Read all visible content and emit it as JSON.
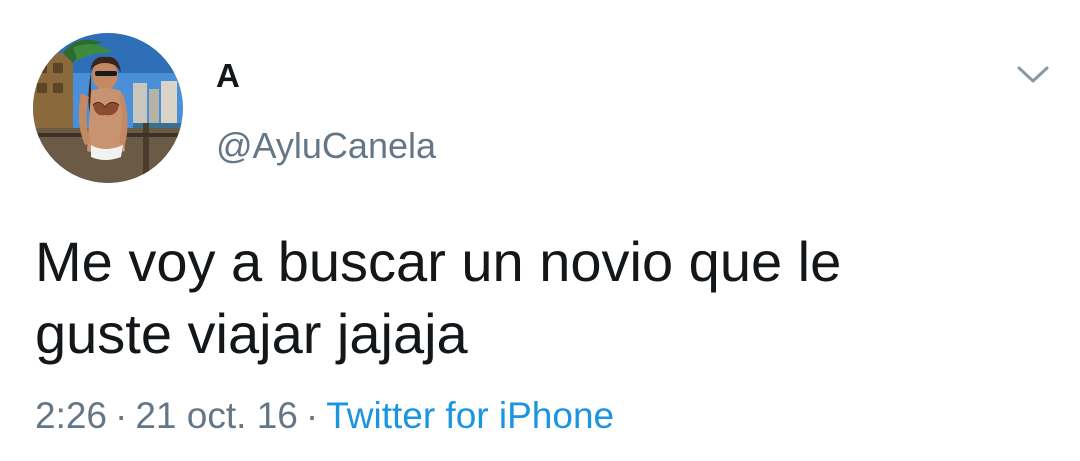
{
  "tweet": {
    "display_name": "A",
    "handle": "@AyluCanela",
    "text_line1": "Me voy a buscar un novio que le",
    "text_line2": "guste viajar jajaja",
    "time": "2:26",
    "separator": "·",
    "date": "21 oct. 16",
    "source": "Twitter for iPhone"
  },
  "icons": {
    "caret": "chevron-down-icon",
    "avatar": "profile-photo"
  },
  "colors": {
    "text": "#14171a",
    "secondary": "#657786",
    "link": "#1b95e0",
    "background": "#ffffff"
  }
}
